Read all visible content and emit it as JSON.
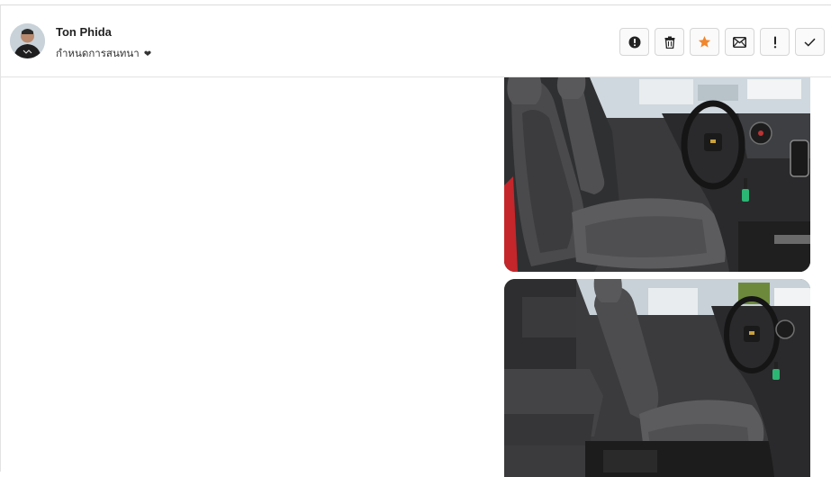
{
  "header": {
    "contact_name": "Ton Phida",
    "subtitle": "กำหนดการสนทนา",
    "subtitle_icon": "heart-icon"
  },
  "actions": [
    {
      "name": "report-button",
      "icon": "exclamation-circle-icon"
    },
    {
      "name": "delete-button",
      "icon": "trash-icon"
    },
    {
      "name": "star-button",
      "icon": "star-icon",
      "color": "#f0862d"
    },
    {
      "name": "mail-button",
      "icon": "envelope-icon"
    },
    {
      "name": "important-button",
      "icon": "exclamation-icon"
    },
    {
      "name": "done-button",
      "icon": "check-icon"
    }
  ],
  "messages": [
    {
      "type": "image",
      "alt": "car interior front seats"
    },
    {
      "type": "image",
      "alt": "car interior cab seats"
    }
  ]
}
